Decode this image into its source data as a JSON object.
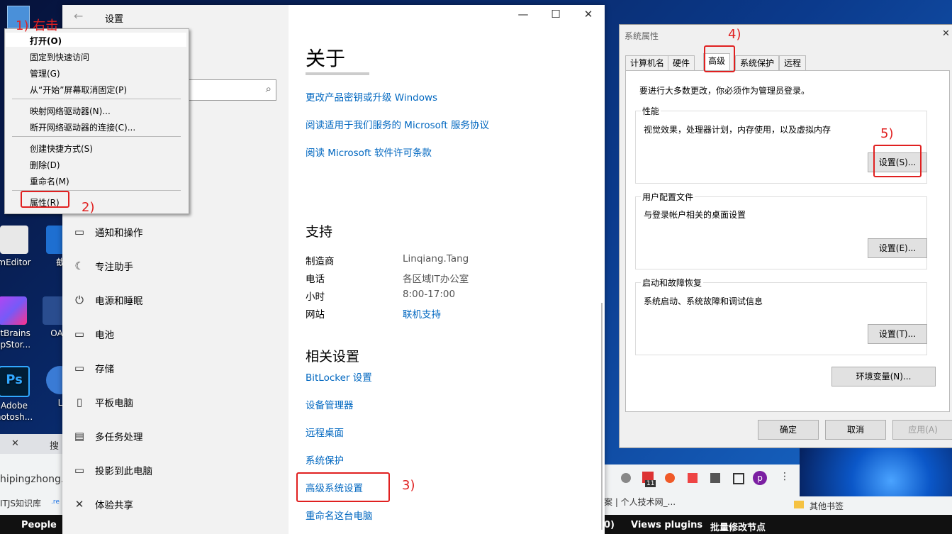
{
  "desktop": {
    "icons": [
      {
        "label": "mEditor",
        "label2": ""
      },
      {
        "label": "截",
        "label2": ""
      },
      {
        "label": "etBrains",
        "label2": "hpStor..."
      },
      {
        "label": "OA",
        "label2": ""
      },
      {
        "label": "Adobe",
        "label2": "hotosh..."
      },
      {
        "label": "L",
        "label2": ""
      }
    ],
    "bottom_labels": [
      "People",
      "0)",
      "Views plugins",
      "批量修改节点"
    ],
    "browser_left": {
      "tab_close": "✕",
      "tab_text": "搜",
      "url": "hipingzhong.",
      "bookmark": "ITJS知识库",
      "bookmark2": ".re"
    },
    "browser_right": {
      "crumb": "案 | 个人技术网_...",
      "bookmarks_other": "其他书签",
      "badge": "11",
      "avatar": "p"
    }
  },
  "settings": {
    "title": "设置",
    "back": "←",
    "controls": {
      "min": "—",
      "max": "☐",
      "close": "✕"
    },
    "search_icon": "⌕",
    "nav": [
      {
        "icon": "notification-icon",
        "glyph": "▭",
        "label": "通知和操作"
      },
      {
        "icon": "moon-icon",
        "glyph": "☾",
        "label": "专注助手"
      },
      {
        "icon": "power-icon",
        "glyph": "⏻",
        "label": "电源和睡眠"
      },
      {
        "icon": "battery-icon",
        "glyph": "▭",
        "label": "电池"
      },
      {
        "icon": "storage-icon",
        "glyph": "▭",
        "label": "存储"
      },
      {
        "icon": "tablet-icon",
        "glyph": "▯",
        "label": "平板电脑"
      },
      {
        "icon": "multitask-icon",
        "glyph": "▤",
        "label": "多任务处理"
      },
      {
        "icon": "project-icon",
        "glyph": "▭",
        "label": "投影到此电脑"
      },
      {
        "icon": "share-icon",
        "glyph": "✕",
        "label": "体验共享"
      }
    ],
    "about": {
      "heading": "关于",
      "links": [
        "更改产品密钥或升级 Windows",
        "阅读适用于我们服务的 Microsoft 服务协议",
        "阅读 Microsoft 软件许可条款"
      ]
    },
    "support": {
      "heading": "支持",
      "rows": [
        {
          "key": "制造商",
          "value": "Linqiang.Tang"
        },
        {
          "key": "电话",
          "value": "各区域IT办公室"
        },
        {
          "key": "小时",
          "value": "8:00-17:00"
        },
        {
          "key": "网站",
          "value": "联机支持"
        }
      ]
    },
    "related": {
      "heading": "相关设置",
      "links": [
        "BitLocker 设置",
        "设备管理器",
        "远程桌面",
        "系统保护",
        "高级系统设置",
        "重命名这台电脑"
      ]
    }
  },
  "context_menu": {
    "items": [
      "打开(O)",
      "固定到快速访问",
      "管理(G)",
      "从“开始”屏幕取消固定(P)",
      "映射网络驱动器(N)...",
      "断开网络驱动器的连接(C)...",
      "创建快捷方式(S)",
      "删除(D)",
      "重命名(M)",
      "属性(R)"
    ]
  },
  "system_properties": {
    "title": "系统属性",
    "close": "✕",
    "tabs": [
      "计算机名",
      "硬件",
      "高级",
      "系统保护",
      "远程"
    ],
    "admin_note": "要进行大多数更改，你必须作为管理员登录。",
    "performance": {
      "title": "性能",
      "desc": "视觉效果，处理器计划，内存使用，以及虚拟内存",
      "button": "设置(S)..."
    },
    "user_profiles": {
      "title": "用户配置文件",
      "desc": "与登录帐户相关的桌面设置",
      "button": "设置(E)..."
    },
    "startup": {
      "title": "启动和故障恢复",
      "desc": "系统启动、系统故障和调试信息",
      "button": "设置(T)..."
    },
    "env_button": "环境变量(N)...",
    "ok": "确定",
    "cancel": "取消",
    "apply": "应用(A)"
  },
  "annotations": {
    "a1": "1) 右击",
    "a2": "2)",
    "a3": "3)",
    "a4": "4)",
    "a5": "5)",
    "color": "#e02020"
  }
}
